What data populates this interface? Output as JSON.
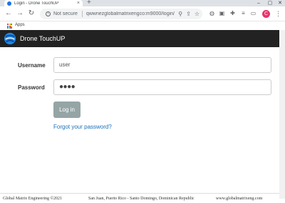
{
  "browser": {
    "tab_title": "Login - Drone TouchUP",
    "tab_close": "×",
    "new_tab": "+",
    "security_text": "Not secure",
    "url": "qwwnezglobalmatrixengco:m9000/login/",
    "apps_label": "Apps",
    "profile_initial": "C",
    "icons": {
      "back": "back-arrow-icon",
      "forward": "forward-arrow-icon",
      "reload": "reload-icon",
      "info": "info-icon",
      "zoom": "zoom-icon",
      "star": "bookmark-star-icon",
      "menu": "kebab-menu-icon"
    }
  },
  "app": {
    "brand": "Drone TouchUP",
    "brand_bg": "#222222"
  },
  "form": {
    "username_label": "Username",
    "username_value": "user",
    "password_label": "Password",
    "password_value": "●●●●",
    "login_label": "Log in",
    "forgot_label": "Forgot your password?",
    "button_color": "#95a5a6",
    "link_color": "#1a6fb8"
  },
  "footer": {
    "copyright": "Global Matrix Engineering ©2021",
    "location": "San Juan, Puerto Rico - Santo Domingo, Dominican Republic",
    "website": "www.globalmatrixeng.com"
  }
}
